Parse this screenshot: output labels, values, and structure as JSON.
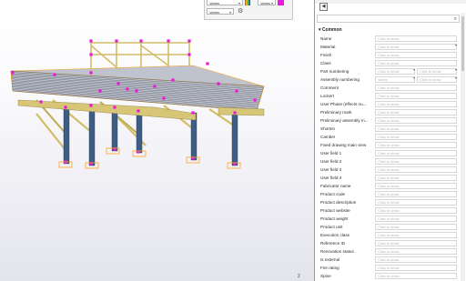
{
  "viewport": {
    "toolbar": {
      "select_top_value": "Varies",
      "select_top_right_value": "Varies",
      "select_bottom_value": "Varies"
    },
    "page_number": "2"
  },
  "panel": {
    "search_placeholder": "",
    "section_title": "Common",
    "placeholder": "Click to show",
    "rows": [
      {
        "label": "Name",
        "value": "Click to show"
      },
      {
        "label": "Material",
        "value": "Click to show",
        "dropdown": true
      },
      {
        "label": "Finish",
        "value": "Click to show"
      },
      {
        "label": "Class",
        "value": "Click to show"
      },
      {
        "label": "Part numbering",
        "value": "Click to show",
        "value2": "Click to show"
      },
      {
        "label": "Assembly numbering",
        "value": "varies",
        "value2": "Click to show"
      },
      {
        "label": "Comment",
        "value": "Click to show"
      },
      {
        "label": "Lockert",
        "value": "Click to show"
      },
      {
        "label": "User Phase  (effects nu...",
        "value": "Click to show"
      },
      {
        "label": "Preliminary mark",
        "value": "Click to show"
      },
      {
        "label": "Preliminary assembly m...",
        "value": "Click to show"
      },
      {
        "label": "Shorten",
        "value": "Click to show"
      },
      {
        "label": "Camber",
        "value": "Click to show"
      },
      {
        "label": "Fixed drawing main view",
        "value": "Click to show"
      },
      {
        "label": "User field 1",
        "value": "Click to show"
      },
      {
        "label": "User field 2",
        "value": "Click to show"
      },
      {
        "label": "User field 3",
        "value": "Click to show"
      },
      {
        "label": "User field 4",
        "value": "Click to show"
      },
      {
        "label": "Fabricator name",
        "value": "Click to show"
      },
      {
        "label": "Product code",
        "value": "Click to show"
      },
      {
        "label": "Product description",
        "value": "Click to show"
      },
      {
        "label": "Product website",
        "value": "Click to show"
      },
      {
        "label": "Product weight",
        "value": "Click to show"
      },
      {
        "label": "Product unit",
        "value": "Click to show"
      },
      {
        "label": "Execution class",
        "value": "Click to show"
      },
      {
        "label": "Reference ID",
        "value": "Click to show"
      },
      {
        "label": "Renovation status",
        "value": "Click to show"
      },
      {
        "label": "Is external",
        "value": "Click to show"
      },
      {
        "label": "Fire rating",
        "value": "Click to show"
      },
      {
        "label": "Spine",
        "value": "Click to show"
      }
    ]
  },
  "colors": {
    "selection_magenta": "#e81ad9",
    "beam_yellow": "#d9c678",
    "beam_edge": "#8a7a3a",
    "column_blue": "#3f5f86",
    "purlin_grey": "#8a8f9a",
    "orange_outline": "#ffa020"
  },
  "icons": {
    "back": "triangle-left-icon",
    "search": "search-icon",
    "collapse": "triangle-down-icon",
    "color_swatch": "color-swatch-icon",
    "gear": "gear-icon"
  }
}
